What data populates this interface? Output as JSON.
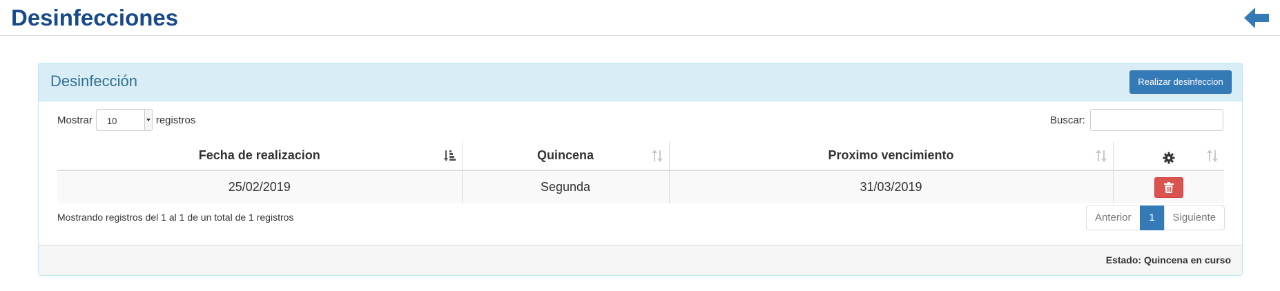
{
  "header": {
    "title": "Desinfecciones",
    "back_icon": "arrow-left-icon"
  },
  "panel": {
    "title": "Desinfección",
    "action_button_label": "Realizar desinfeccion"
  },
  "length_control": {
    "prefix": "Mostrar",
    "selected": "10",
    "suffix": "registros"
  },
  "search": {
    "label": "Buscar:",
    "value": "",
    "placeholder": ""
  },
  "table": {
    "columns": [
      {
        "label": "Fecha de realizacion",
        "sort": "active"
      },
      {
        "label": "Quincena",
        "sort": "both"
      },
      {
        "label": "Proximo vencimiento",
        "sort": "both"
      },
      {
        "label": "",
        "icon": "gear-icon",
        "sort": "both"
      }
    ],
    "rows": [
      {
        "fecha": "25/02/2019",
        "quincena": "Segunda",
        "vencimiento": "31/03/2019",
        "action_icon": "trash-icon"
      }
    ]
  },
  "info": "Mostrando registros del 1 al 1 de un total de 1 registros",
  "pagination": {
    "previous": "Anterior",
    "current": "1",
    "next": "Siguiente"
  },
  "footer": {
    "status": "Estado: Quincena en curso"
  },
  "colors": {
    "title": "#184a8a",
    "panel_heading_bg": "#d9edf7",
    "primary": "#337ab7",
    "danger": "#d9534f"
  }
}
